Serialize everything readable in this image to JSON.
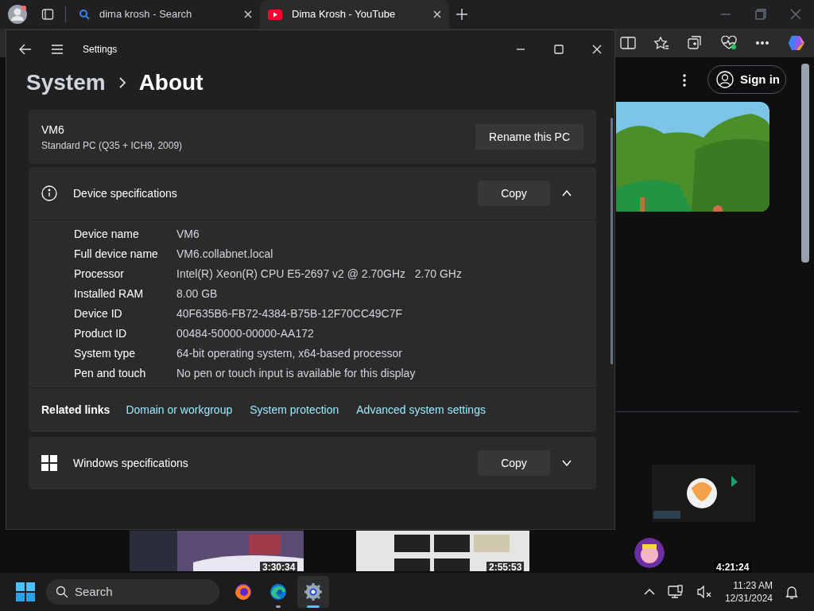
{
  "browser": {
    "tabs": [
      {
        "title": "dima krosh - Search",
        "kind": "search",
        "selected": false
      },
      {
        "title": "Dima Krosh - YouTube",
        "kind": "youtube",
        "selected": true
      }
    ]
  },
  "youtube": {
    "sign_in": "Sign in",
    "durations": [
      "3:30:34",
      "2:55:53",
      "4:21:24"
    ]
  },
  "settings": {
    "title": "Settings",
    "breadcrumb": [
      "System",
      "About"
    ],
    "pc": {
      "name": "VM6",
      "model": "Standard PC (Q35 + ICH9, 2009)",
      "button": "Rename this PC"
    },
    "device_specs": {
      "title": "Device specifications",
      "copy": "Copy",
      "expanded": true,
      "rows": [
        {
          "label": "Device name",
          "value": "VM6"
        },
        {
          "label": "Full device name",
          "value": "VM6.collabnet.local"
        },
        {
          "label": "Processor",
          "value": "Intel(R) Xeon(R) CPU E5-2697 v2 @ 2.70GHz   2.70 GHz"
        },
        {
          "label": "Installed RAM",
          "value": "8.00 GB"
        },
        {
          "label": "Device ID",
          "value": "40F635B6-FB72-4384-B75B-12F70CC49C7F"
        },
        {
          "label": "Product ID",
          "value": "00484-50000-00000-AA172"
        },
        {
          "label": "System type",
          "value": "64-bit operating system, x64-based processor"
        },
        {
          "label": "Pen and touch",
          "value": "No pen or touch input is available for this display"
        }
      ]
    },
    "related": {
      "label": "Related links",
      "links": [
        "Domain or workgroup",
        "System protection",
        "Advanced system settings"
      ]
    },
    "windows_specs": {
      "title": "Windows specifications",
      "copy": "Copy",
      "expanded": false
    }
  },
  "taskbar": {
    "search": {
      "placeholder": "Search"
    },
    "apps": [
      {
        "kind": "firefox",
        "running": false,
        "active": false
      },
      {
        "kind": "edge",
        "running": true,
        "active": false
      },
      {
        "kind": "settings",
        "running": true,
        "active": true
      }
    ],
    "time": "11:23 AM",
    "date": "12/31/2024"
  }
}
